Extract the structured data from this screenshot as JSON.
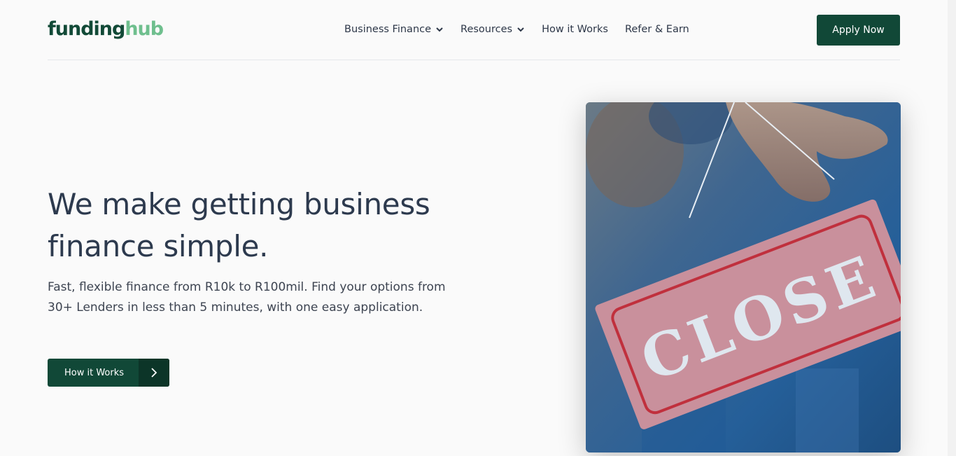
{
  "brand": {
    "part1": "funding",
    "part2": "hub"
  },
  "nav": {
    "items": [
      {
        "label": "Business Finance",
        "has_dropdown": true
      },
      {
        "label": "Resources",
        "has_dropdown": true
      },
      {
        "label": "How it Works",
        "has_dropdown": false
      },
      {
        "label": "Refer & Earn",
        "has_dropdown": false
      }
    ],
    "apply_label": "Apply Now"
  },
  "hero": {
    "title": "We make getting business finance simple.",
    "subtitle": "Fast, flexible finance from R10k to R100mil. Find your options from 30+ Lenders in less than 5 minutes, with one easy application.",
    "cta_label": "How it Works",
    "image_sign_text": "CLOSE"
  },
  "colors": {
    "primary": "#114837",
    "primary_dark": "#0c3528",
    "brand_light": "#6fbf8e",
    "text": "#2d3a4e"
  }
}
